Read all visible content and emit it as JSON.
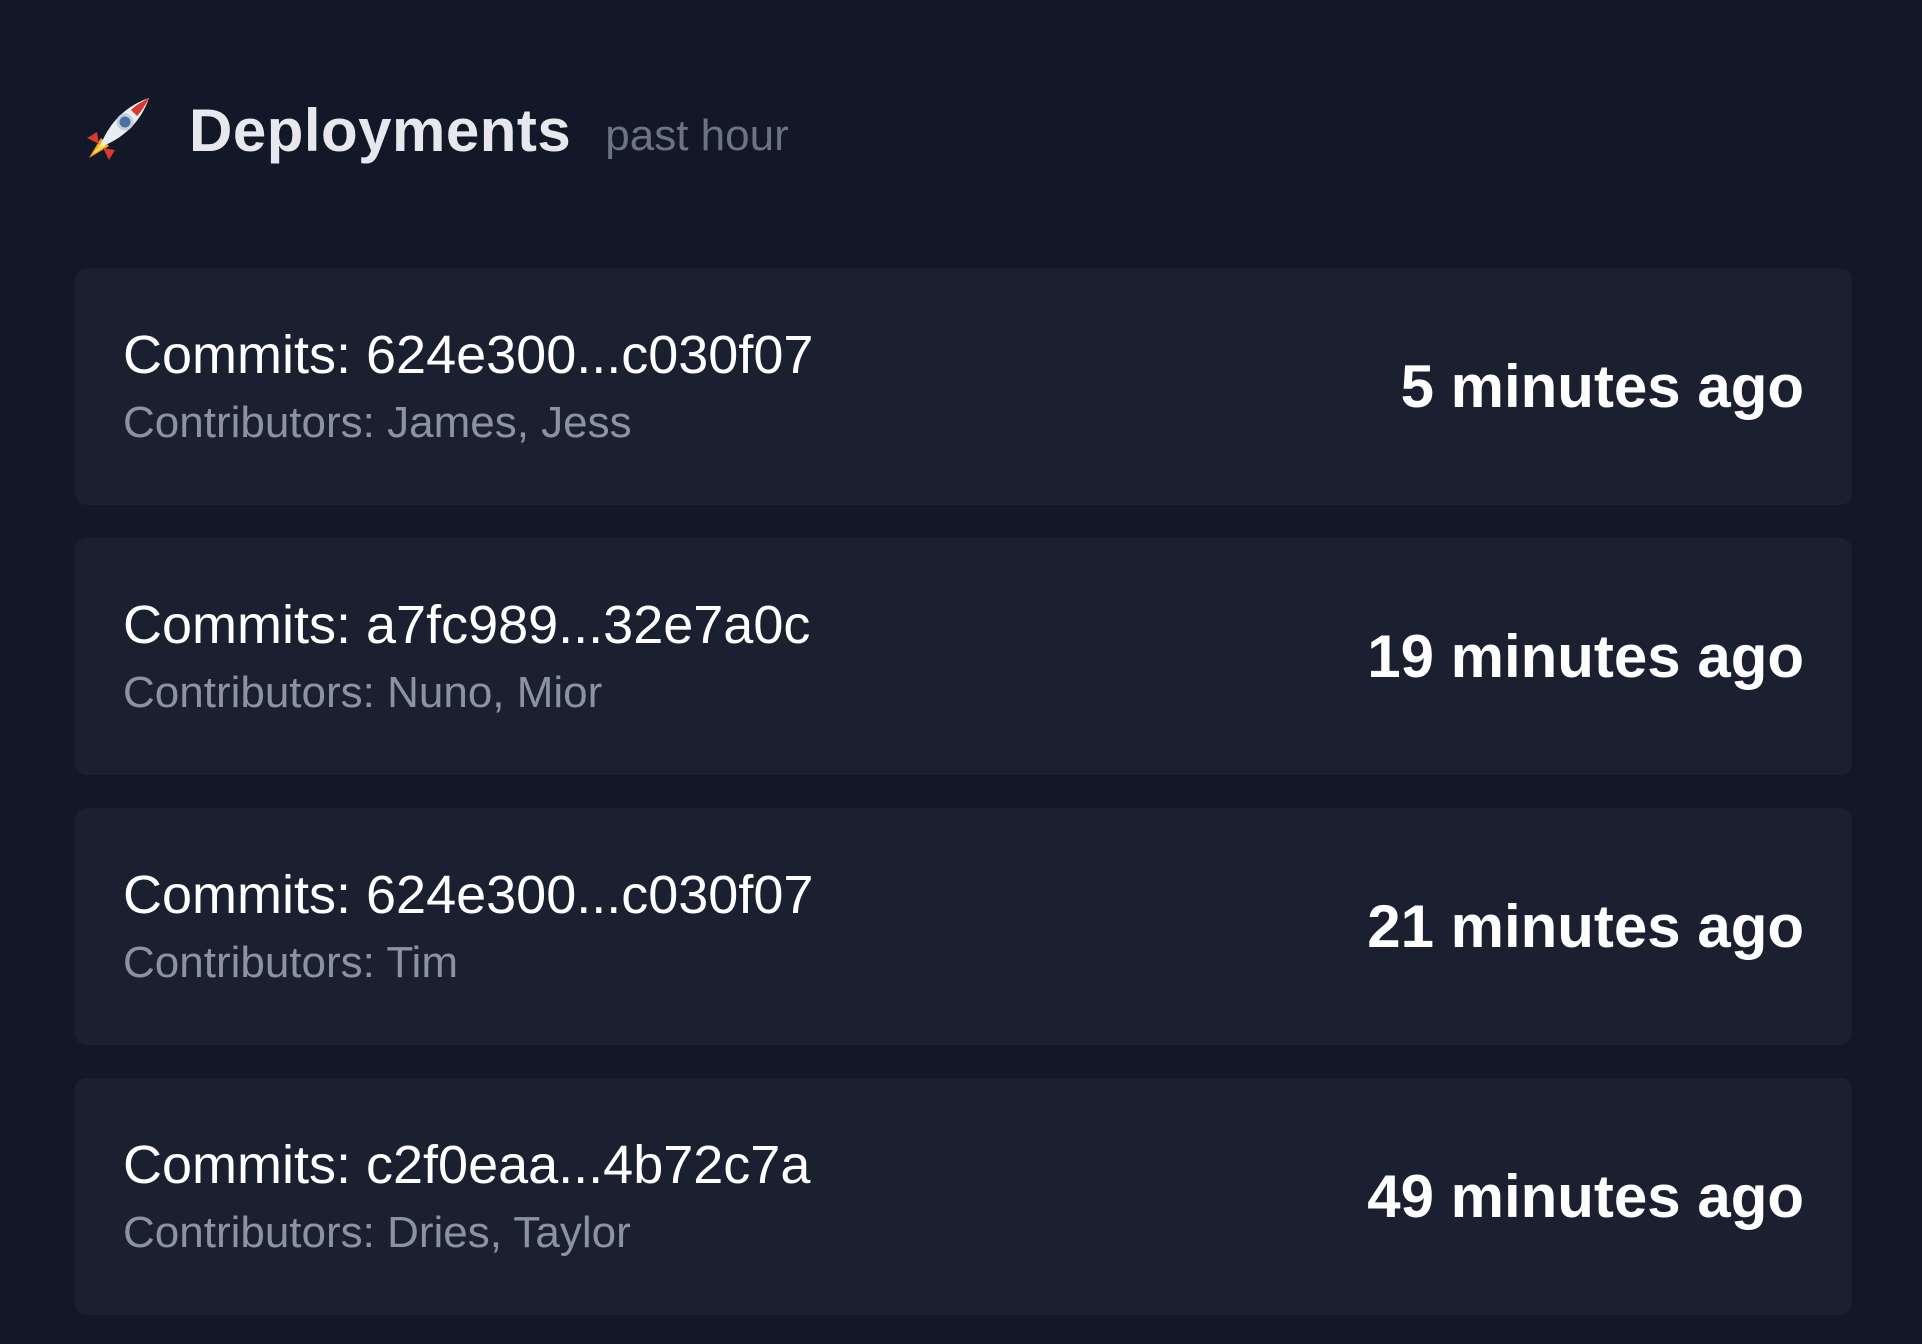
{
  "header": {
    "icon": "rocket-icon",
    "title": "Deployments",
    "subtitle": "past hour"
  },
  "deployments": [
    {
      "commits": "Commits: 624e300...c030f07",
      "contributors": "Contributors: James, Jess",
      "time": "5 minutes ago"
    },
    {
      "commits": "Commits: a7fc989...32e7a0c",
      "contributors": "Contributors: Nuno, Mior",
      "time": "19 minutes ago"
    },
    {
      "commits": "Commits: 624e300...c030f07",
      "contributors": "Contributors: Tim",
      "time": "21 minutes ago"
    },
    {
      "commits": "Commits: c2f0eaa...4b72c7a",
      "contributors": "Contributors: Dries, Taylor",
      "time": "49 minutes ago"
    }
  ],
  "colors": {
    "background": "#121828",
    "card": "#1a2030",
    "primary_text": "#ffffff",
    "secondary_text": "#8b93a3",
    "muted_text": "#6b7385"
  }
}
